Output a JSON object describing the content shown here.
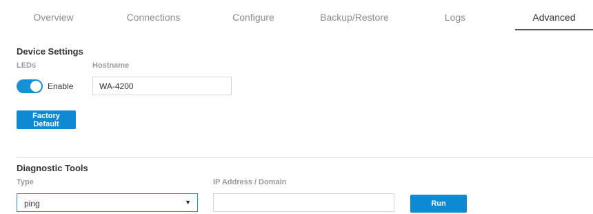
{
  "tabs": [
    {
      "label": "Overview"
    },
    {
      "label": "Connections"
    },
    {
      "label": "Configure"
    },
    {
      "label": "Backup/Restore"
    },
    {
      "label": "Logs"
    },
    {
      "label": "Advanced",
      "active": true
    }
  ],
  "device_settings": {
    "title": "Device Settings",
    "leds_label": "LEDs",
    "leds_toggle_text": "Enable",
    "leds_enabled": true,
    "hostname_label": "Hostname",
    "hostname_value": "WA-4200",
    "factory_default_label": "Factory Default"
  },
  "diagnostic_tools": {
    "title": "Diagnostic Tools",
    "type_label": "Type",
    "type_value": "ping",
    "ip_label": "IP Address / Domain",
    "ip_value": "",
    "run_label": "Run"
  },
  "colors": {
    "accent": "#0e8ad4",
    "toggle_on": "#1b8fd4",
    "label_gray": "#9a9a9a",
    "tab_inactive": "#8c8c8c"
  },
  "icons": {
    "select_caret": "caret-down-icon"
  }
}
